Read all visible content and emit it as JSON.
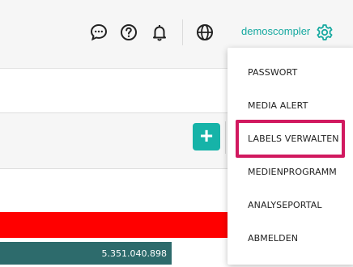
{
  "header": {
    "username": "demoscompler",
    "icons": [
      "chat-icon",
      "help-icon",
      "bell-icon",
      "globe-icon",
      "gear-icon"
    ],
    "accent_color": "#17a9a0"
  },
  "menu": {
    "items": [
      {
        "label": "PASSWORT"
      },
      {
        "label": "MEDIA ALERT"
      },
      {
        "label": "LABELS VERWALTEN",
        "highlighted": true
      },
      {
        "label": "MEDIENPROGRAMM"
      },
      {
        "label": "ANALYSEPORTAL"
      },
      {
        "label": "ABMELDEN"
      }
    ],
    "highlight_color": "#d1195f"
  },
  "content": {
    "green_bar_value": "5.351.040.898",
    "bar_colors": {
      "red": "#ff0000",
      "green": "#2d6b6c"
    },
    "add_button_label": "+"
  }
}
